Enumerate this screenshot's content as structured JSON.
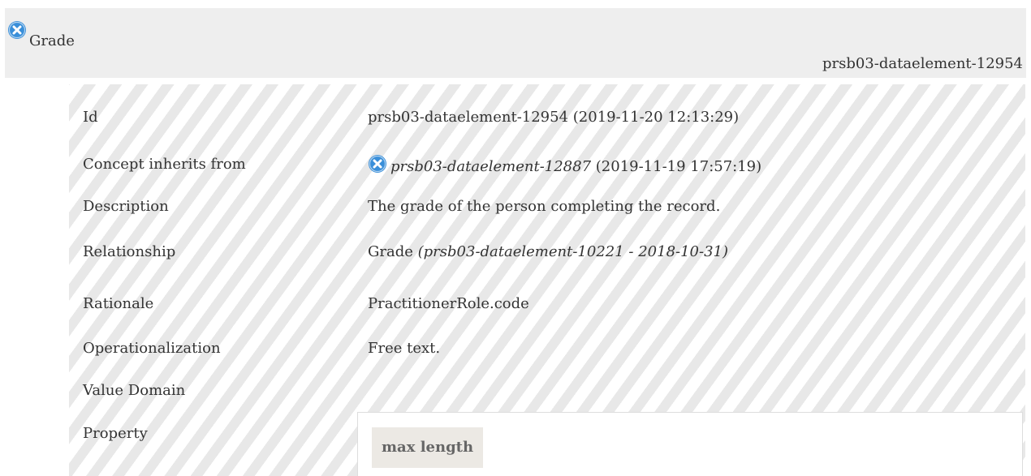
{
  "header": {
    "title": "Grade",
    "id": "prsb03-dataelement-12954",
    "icon": "close-circle-icon"
  },
  "rows": [
    {
      "label": "Id",
      "value": "prsb03-dataelement-12954 (2019-11-20 12:13:29)"
    },
    {
      "label": "Concept inherits from",
      "value_link": "prsb03-dataelement-12887",
      "value_suffix": " (2019-11-19 17:57:19)",
      "icon": "close-circle-icon"
    },
    {
      "label": "Description",
      "value": "The grade of the person completing the record."
    },
    {
      "label": "Relationship",
      "value_prefix": "Grade ",
      "value_italic": "(prsb03-dataelement-10221 - 2018-10-31)"
    },
    {
      "label": "Rationale",
      "value": "PractitionerRole.code"
    },
    {
      "label": "Operationalization",
      "value": "Free text."
    },
    {
      "label": "Value Domain",
      "value": ""
    },
    {
      "label": "Property",
      "value": ""
    }
  ],
  "property_table": {
    "header": "max length"
  },
  "colors": {
    "header_bg": "#eeeeee",
    "icon_blue": "#3a8fd9",
    "stripe": "#e8e8e8"
  }
}
